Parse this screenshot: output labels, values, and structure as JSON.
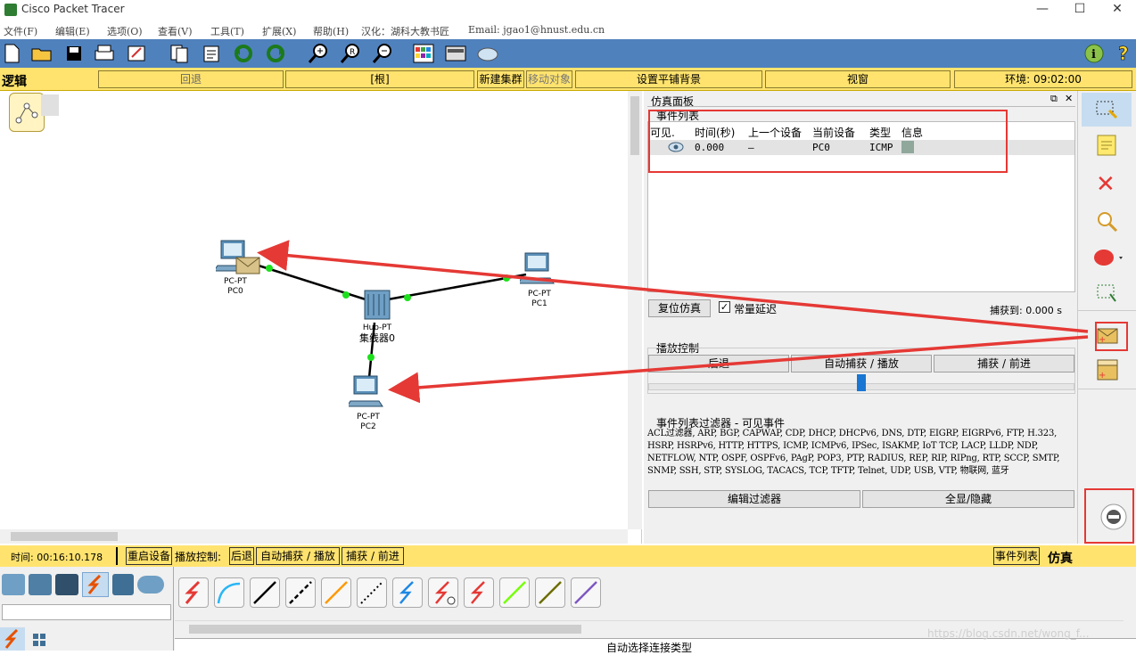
{
  "window": {
    "title": "Cisco Packet Tracer",
    "controls": [
      "—",
      "☐",
      "✕"
    ]
  },
  "menu": {
    "items": [
      "文件(F)",
      "编辑(E)",
      "选项(O)",
      "查看(V)",
      "工具(T)",
      "扩展(X)",
      "帮助(H)",
      "汉化：湖科大教书匠",
      "Email: jgao1@hnust.edu.cn"
    ]
  },
  "modebar": {
    "mode": "逻辑",
    "back": "回退",
    "root": "[根]",
    "new_cluster": "新建集群",
    "move_object": "移动对象",
    "tiled_bg": "设置平铺背景",
    "viewport": "视窗",
    "environment": "环境: 09:02:00"
  },
  "devices": {
    "pc0": {
      "type": "PC-PT",
      "name": "PC0"
    },
    "pc1": {
      "type": "PC-PT",
      "name": "PC1"
    },
    "pc2": {
      "type": "PC-PT",
      "name": "PC2"
    },
    "hub": {
      "type": "Hub-PT",
      "name": "集线器0"
    }
  },
  "sim_panel": {
    "title": "仿真面板",
    "event_list_label": "事件列表",
    "columns": [
      "可见.",
      "时间(秒)",
      "上一个设备",
      "当前设备",
      "类型",
      "信息"
    ],
    "rows": [
      {
        "time": "0.000",
        "last_device": "—",
        "current_device": "PC0",
        "type": "ICMP",
        "info_color": "#8fa89b"
      }
    ],
    "reset_sim": "复位仿真",
    "constant_delay": "常量延迟",
    "captured_to": "捕获到: 0.000 s",
    "play_controls": "播放控制",
    "back": "后退",
    "auto_capture": "自动捕获 / 播放",
    "capture_forward": "捕获 / 前进",
    "filter_title": "事件列表过滤器 - 可见事件",
    "filter_text": "ACL过滤器, ARP, BGP, CAPWAP, CDP, DHCP, DHCPv6, DNS, DTP, EIGRP, EIGRPv6, FTP, H.323, HSRP, HSRPv6, HTTP, HTTPS, ICMP, ICMPv6, IPSec, ISAKMP, IoT TCP, LACP, LLDP, NDP, NETFLOW, NTP, OSPF, OSPFv6, PAgP, POP3, PTP, RADIUS, REP, RIP, RIPng, RTP, SCCP, SMTP, SNMP, SSH, STP, SYSLOG, TACACS, TCP, TFTP, Telnet, UDP, USB, VTP, 物联网, 蓝牙",
    "edit_filter": "编辑过滤器",
    "show_hide": "全显/隐藏"
  },
  "statusbar": {
    "time": "时间: 00:16:10.178",
    "restart": "重启设备",
    "play_label": "播放控制:",
    "back": "后退",
    "auto": "自动捕获 / 播放",
    "capture": "捕获 / 前进",
    "event_list": "事件列表",
    "sim": "仿真"
  },
  "palette": {
    "bottom_label": "自动选择连接类型",
    "connection_colors": [
      "#e53935",
      "#29b6f6",
      "#000000",
      "#000000",
      "#ff9800",
      "#000000",
      "#1e88e5",
      "#e53935",
      "#e53935",
      "#76ff03",
      "#6d6d00",
      "#7e57c2"
    ]
  },
  "watermark": "https://blog.csdn.net/wong_f..."
}
